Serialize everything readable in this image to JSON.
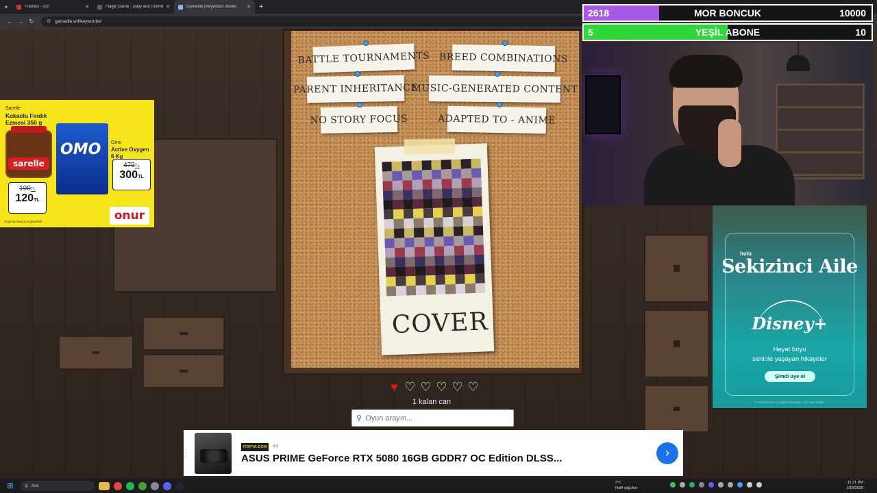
{
  "browser": {
    "tabs": [
      {
        "label": "Framed - #20",
        "color": "#d93025",
        "active": false
      },
      {
        "label": "Flagle Game - Daily and Unlimited",
        "color": "#5f6368",
        "active": false
      },
      {
        "label": "Gamedle (Keywords mode)",
        "color": "#8ab4f8",
        "active": true
      }
    ],
    "new_tab": "+",
    "url": "gamedle.wtf/keywords#"
  },
  "board": {
    "keywords": [
      "BATTLE TOURNAMENTS",
      "BREED COMBINATIONS",
      "PARENT INHERITANCE",
      "MUSIC-GENERATED CONTENT",
      "NO STORY FOCUS",
      "ADAPTED TO - ANIME"
    ],
    "cover_label": "COVER"
  },
  "lives": {
    "total": 6,
    "remaining": 1,
    "text": "1 kalan can",
    "heart_color": "#e01818"
  },
  "search": {
    "placeholder": "Oyun arayın..."
  },
  "vote_bars": [
    {
      "count": "2618",
      "label": "MOR BONCUK",
      "goal": "10000",
      "progress": 0.2618,
      "color": "#a85ae6"
    },
    {
      "count": "5",
      "label": "YEŞİL ABONE",
      "goal": "10",
      "progress": 0.5,
      "color": "#2fd83a"
    }
  ],
  "ad_left": {
    "product1_brand": "Sarelle",
    "product1_name": "Kakaolu Fındık Ezmesi 350 g",
    "product1_label": "sarelle",
    "product1_old": "190",
    "product1_new": "120",
    "product2_brand": "Omo",
    "product2_name": "Active Oxygen 6 Kg",
    "product2_label": "OMO",
    "product2_old": "475",
    "product2_new": "300",
    "currency": "TL",
    "logo": "onur",
    "footnote": "Ocak ayı boyunca geçerlidir."
  },
  "ad_right": {
    "network": "hulu",
    "show_title": "Sekizinci Aile",
    "brand": "Disney+",
    "tagline_1": "Hayat boyu",
    "tagline_2": "seninle yaşayan hikayeler",
    "cta": "Şimdi üye ol",
    "legal": "© 2026 Disney ve bağlı kuruluşları. 18+ üye olabilir."
  },
  "ad_bottom": {
    "store": "ITOPYA.COM",
    "rating": "4.6",
    "product": "ASUS PRIME GeForce RTX 5080 16GB GDDR7 OC Edition DLSS...",
    "arrow": "›"
  },
  "taskbar": {
    "search_label": "Ara",
    "weather_temp": "3°C",
    "weather_desc": "Hafif yağ./kar",
    "time": "11:21 PM",
    "date": "1/16/2026"
  }
}
